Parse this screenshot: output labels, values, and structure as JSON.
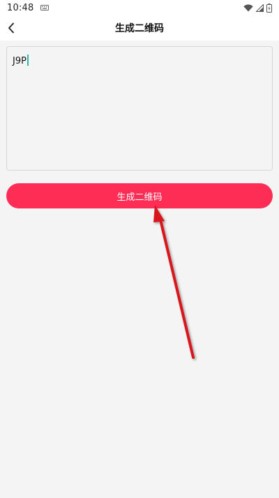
{
  "status_bar": {
    "time": "10:48",
    "icons": [
      "keyboard-icon",
      "wifi-icon",
      "signal-icon",
      "battery-icon"
    ]
  },
  "header": {
    "title": "生成二维码",
    "back_icon": "chevron-left-icon"
  },
  "input": {
    "value": "J9P",
    "caret_color": "#29b7b0"
  },
  "generate_button": {
    "label": "生成二维码",
    "color": "#fe2d55"
  },
  "annotation": {
    "type": "arrow",
    "color": "#d9161c",
    "points_to": "generate-button"
  }
}
